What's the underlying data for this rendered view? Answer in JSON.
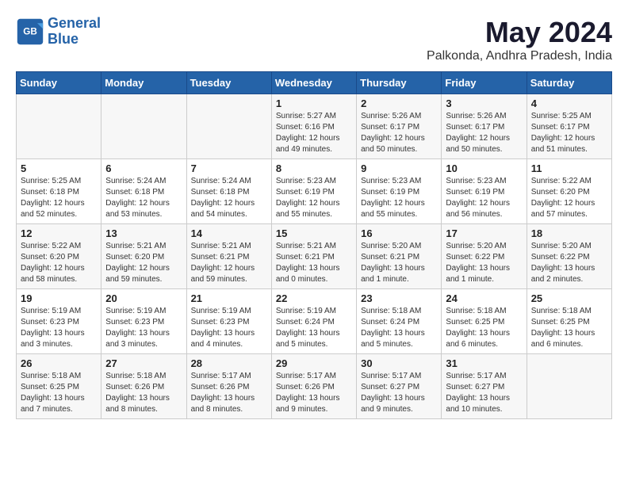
{
  "logo": {
    "line1": "General",
    "line2": "Blue"
  },
  "title": "May 2024",
  "subtitle": "Palkonda, Andhra Pradesh, India",
  "weekdays": [
    "Sunday",
    "Monday",
    "Tuesday",
    "Wednesday",
    "Thursday",
    "Friday",
    "Saturday"
  ],
  "weeks": [
    [
      {
        "day": "",
        "info": ""
      },
      {
        "day": "",
        "info": ""
      },
      {
        "day": "",
        "info": ""
      },
      {
        "day": "1",
        "info": "Sunrise: 5:27 AM\nSunset: 6:16 PM\nDaylight: 12 hours\nand 49 minutes."
      },
      {
        "day": "2",
        "info": "Sunrise: 5:26 AM\nSunset: 6:17 PM\nDaylight: 12 hours\nand 50 minutes."
      },
      {
        "day": "3",
        "info": "Sunrise: 5:26 AM\nSunset: 6:17 PM\nDaylight: 12 hours\nand 50 minutes."
      },
      {
        "day": "4",
        "info": "Sunrise: 5:25 AM\nSunset: 6:17 PM\nDaylight: 12 hours\nand 51 minutes."
      }
    ],
    [
      {
        "day": "5",
        "info": "Sunrise: 5:25 AM\nSunset: 6:18 PM\nDaylight: 12 hours\nand 52 minutes."
      },
      {
        "day": "6",
        "info": "Sunrise: 5:24 AM\nSunset: 6:18 PM\nDaylight: 12 hours\nand 53 minutes."
      },
      {
        "day": "7",
        "info": "Sunrise: 5:24 AM\nSunset: 6:18 PM\nDaylight: 12 hours\nand 54 minutes."
      },
      {
        "day": "8",
        "info": "Sunrise: 5:23 AM\nSunset: 6:19 PM\nDaylight: 12 hours\nand 55 minutes."
      },
      {
        "day": "9",
        "info": "Sunrise: 5:23 AM\nSunset: 6:19 PM\nDaylight: 12 hours\nand 55 minutes."
      },
      {
        "day": "10",
        "info": "Sunrise: 5:23 AM\nSunset: 6:19 PM\nDaylight: 12 hours\nand 56 minutes."
      },
      {
        "day": "11",
        "info": "Sunrise: 5:22 AM\nSunset: 6:20 PM\nDaylight: 12 hours\nand 57 minutes."
      }
    ],
    [
      {
        "day": "12",
        "info": "Sunrise: 5:22 AM\nSunset: 6:20 PM\nDaylight: 12 hours\nand 58 minutes."
      },
      {
        "day": "13",
        "info": "Sunrise: 5:21 AM\nSunset: 6:20 PM\nDaylight: 12 hours\nand 59 minutes."
      },
      {
        "day": "14",
        "info": "Sunrise: 5:21 AM\nSunset: 6:21 PM\nDaylight: 12 hours\nand 59 minutes."
      },
      {
        "day": "15",
        "info": "Sunrise: 5:21 AM\nSunset: 6:21 PM\nDaylight: 13 hours\nand 0 minutes."
      },
      {
        "day": "16",
        "info": "Sunrise: 5:20 AM\nSunset: 6:21 PM\nDaylight: 13 hours\nand 1 minute."
      },
      {
        "day": "17",
        "info": "Sunrise: 5:20 AM\nSunset: 6:22 PM\nDaylight: 13 hours\nand 1 minute."
      },
      {
        "day": "18",
        "info": "Sunrise: 5:20 AM\nSunset: 6:22 PM\nDaylight: 13 hours\nand 2 minutes."
      }
    ],
    [
      {
        "day": "19",
        "info": "Sunrise: 5:19 AM\nSunset: 6:23 PM\nDaylight: 13 hours\nand 3 minutes."
      },
      {
        "day": "20",
        "info": "Sunrise: 5:19 AM\nSunset: 6:23 PM\nDaylight: 13 hours\nand 3 minutes."
      },
      {
        "day": "21",
        "info": "Sunrise: 5:19 AM\nSunset: 6:23 PM\nDaylight: 13 hours\nand 4 minutes."
      },
      {
        "day": "22",
        "info": "Sunrise: 5:19 AM\nSunset: 6:24 PM\nDaylight: 13 hours\nand 5 minutes."
      },
      {
        "day": "23",
        "info": "Sunrise: 5:18 AM\nSunset: 6:24 PM\nDaylight: 13 hours\nand 5 minutes."
      },
      {
        "day": "24",
        "info": "Sunrise: 5:18 AM\nSunset: 6:25 PM\nDaylight: 13 hours\nand 6 minutes."
      },
      {
        "day": "25",
        "info": "Sunrise: 5:18 AM\nSunset: 6:25 PM\nDaylight: 13 hours\nand 6 minutes."
      }
    ],
    [
      {
        "day": "26",
        "info": "Sunrise: 5:18 AM\nSunset: 6:25 PM\nDaylight: 13 hours\nand 7 minutes."
      },
      {
        "day": "27",
        "info": "Sunrise: 5:18 AM\nSunset: 6:26 PM\nDaylight: 13 hours\nand 8 minutes."
      },
      {
        "day": "28",
        "info": "Sunrise: 5:17 AM\nSunset: 6:26 PM\nDaylight: 13 hours\nand 8 minutes."
      },
      {
        "day": "29",
        "info": "Sunrise: 5:17 AM\nSunset: 6:26 PM\nDaylight: 13 hours\nand 9 minutes."
      },
      {
        "day": "30",
        "info": "Sunrise: 5:17 AM\nSunset: 6:27 PM\nDaylight: 13 hours\nand 9 minutes."
      },
      {
        "day": "31",
        "info": "Sunrise: 5:17 AM\nSunset: 6:27 PM\nDaylight: 13 hours\nand 10 minutes."
      },
      {
        "day": "",
        "info": ""
      }
    ]
  ],
  "colors": {
    "header_bg": "#2563a8",
    "header_text": "#ffffff",
    "odd_row": "#f7f7f7",
    "even_row": "#ffffff"
  }
}
